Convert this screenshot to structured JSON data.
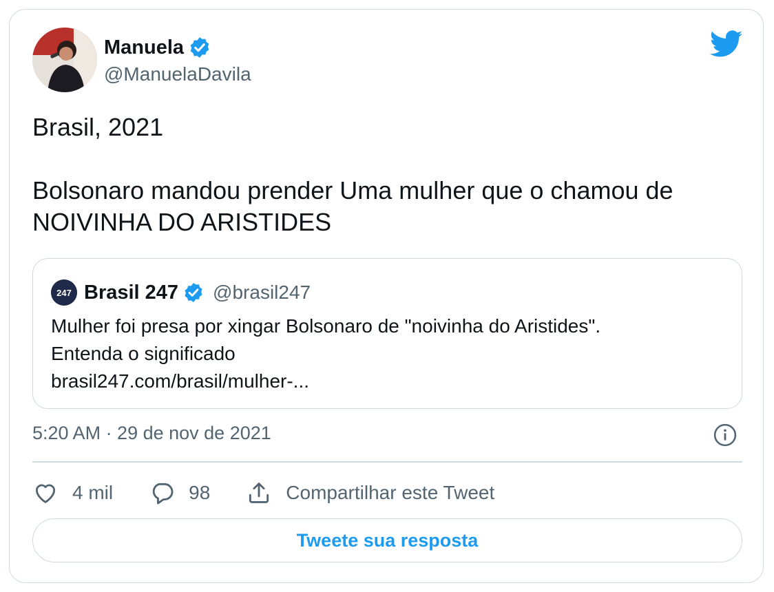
{
  "tweet": {
    "author_name": "Manuela",
    "author_handle": "@ManuelaDavila",
    "text": "Brasil, 2021\n\nBolsonaro mandou prender Uma mulher que o chamou de NOIVINHA DO ARISTIDES",
    "timestamp": "5:20 AM · 29 de nov de 2021"
  },
  "quoted_tweet": {
    "author_name": "Brasil 247",
    "author_handle": "@brasil247",
    "avatar_text": "247",
    "text": "Mulher foi presa por xingar Bolsonaro de \"noivinha do Aristides\".\nEntenda o significado\nbrasil247.com/brasil/mulher-..."
  },
  "actions": {
    "likes": "4 mil",
    "replies": "98",
    "share_label": "Compartilhar este Tweet"
  },
  "reply_button": "Tweete sua resposta",
  "icons": [
    "verified-badge-icon",
    "twitter-bird-icon",
    "info-icon",
    "heart-icon",
    "reply-bubble-icon",
    "share-icon"
  ],
  "colors": {
    "brand_blue": "#1d9bf0",
    "text": "#0f1419",
    "secondary_text": "#536471",
    "border": "#cfd9de"
  }
}
